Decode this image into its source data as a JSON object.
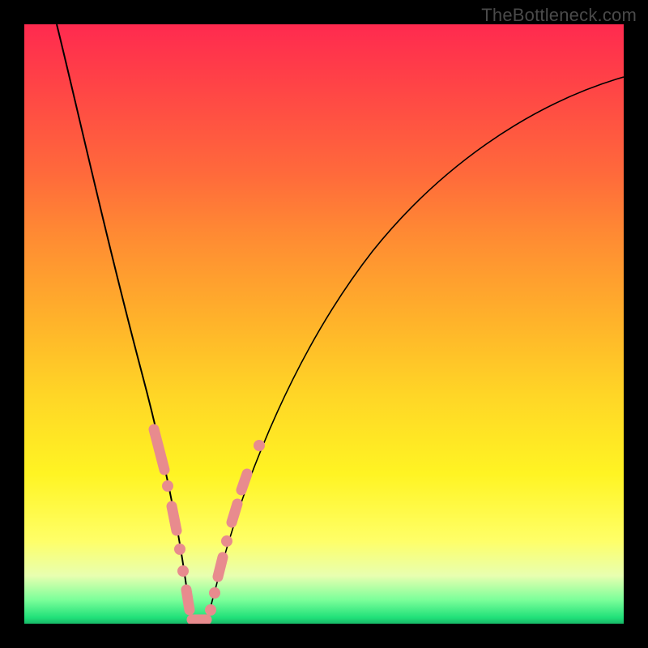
{
  "watermark": "TheBottleneck.com",
  "chart_data": {
    "type": "line",
    "title": "",
    "xlabel": "",
    "ylabel": "",
    "xlim": [
      0,
      100
    ],
    "ylim": [
      0,
      100
    ],
    "series": [
      {
        "name": "bottleneck-curve",
        "x": [
          0,
          3,
          6,
          9,
          12,
          15,
          18,
          20,
          22,
          24,
          25,
          26,
          27,
          28,
          30,
          33,
          37,
          42,
          48,
          55,
          63,
          72,
          82,
          92,
          100
        ],
        "y": [
          100,
          91,
          82,
          72,
          62,
          51,
          39,
          30,
          21,
          11,
          5,
          1,
          0,
          1,
          6,
          14,
          26,
          39,
          53,
          65,
          75,
          83,
          88,
          91,
          93
        ]
      }
    ],
    "markers": {
      "name": "highlighted-range",
      "points": [
        {
          "x": 20.5,
          "y": 28,
          "kind": "segment",
          "len": 6
        },
        {
          "x": 22.0,
          "y": 21,
          "kind": "dot"
        },
        {
          "x": 23.0,
          "y": 16,
          "kind": "segment",
          "len": 4
        },
        {
          "x": 24.0,
          "y": 11,
          "kind": "dot"
        },
        {
          "x": 24.8,
          "y": 7,
          "kind": "dot"
        },
        {
          "x": 25.5,
          "y": 3,
          "kind": "segment",
          "len": 4
        },
        {
          "x": 26.5,
          "y": 0.5,
          "kind": "segment",
          "len": 6
        },
        {
          "x": 28.0,
          "y": 1,
          "kind": "dot"
        },
        {
          "x": 29.0,
          "y": 4,
          "kind": "dot"
        },
        {
          "x": 30.0,
          "y": 7,
          "kind": "segment",
          "len": 4
        },
        {
          "x": 31.0,
          "y": 11,
          "kind": "dot"
        },
        {
          "x": 32.5,
          "y": 15,
          "kind": "segment",
          "len": 4
        },
        {
          "x": 34.0,
          "y": 20,
          "kind": "segment",
          "len": 3
        },
        {
          "x": 36.5,
          "y": 27,
          "kind": "dot"
        }
      ]
    },
    "gradient_meaning": "background hue encodes bottleneck severity (red high, green low)"
  }
}
